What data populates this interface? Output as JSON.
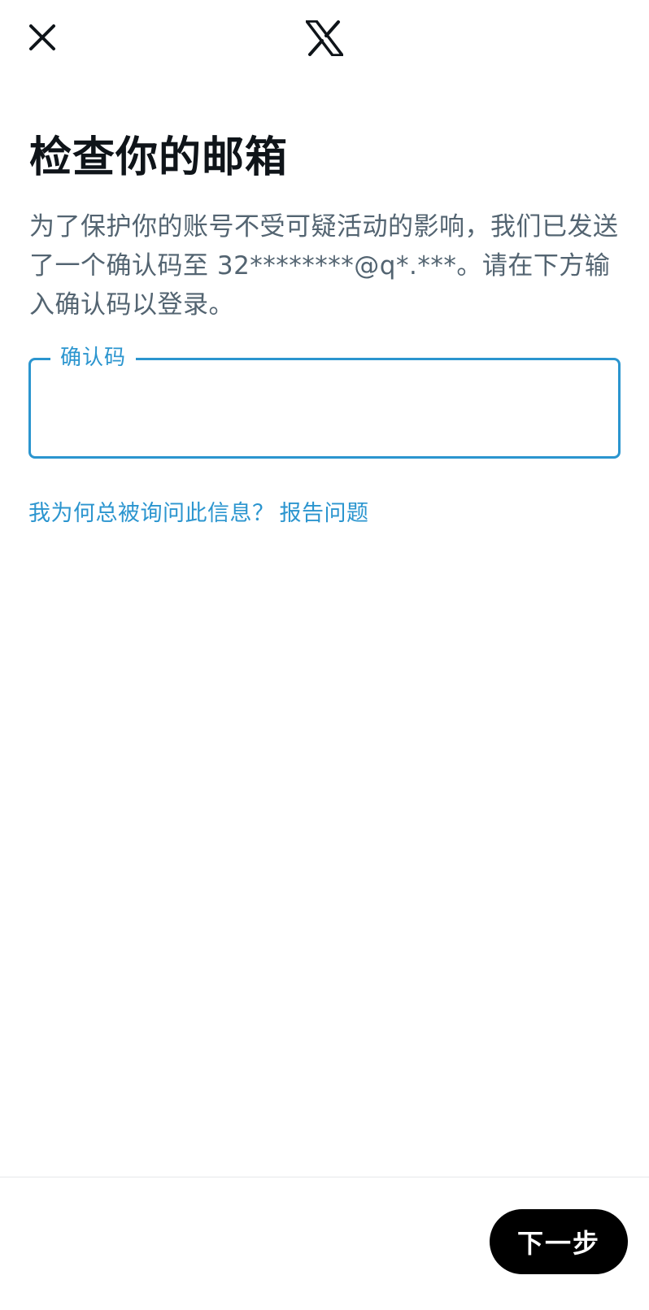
{
  "header": {
    "close_icon": "close-icon",
    "logo_icon": "x-logo-icon"
  },
  "main": {
    "title": "检查你的邮箱",
    "description": "为了保护你的账号不受可疑活动的影响，我们已发送了一个确认码至 32********@q*.***。请在下方输入确认码以登录。",
    "code_field": {
      "label": "确认码",
      "value": ""
    },
    "help": {
      "why_link": "我为何总被询问此信息？",
      "report_link": "报告问题"
    }
  },
  "footer": {
    "next_label": "下一步"
  },
  "colors": {
    "accent": "#2b95cf",
    "primary_text": "#0f1419",
    "secondary_text": "#536471",
    "button_bg": "#000000",
    "button_text": "#ffffff"
  }
}
